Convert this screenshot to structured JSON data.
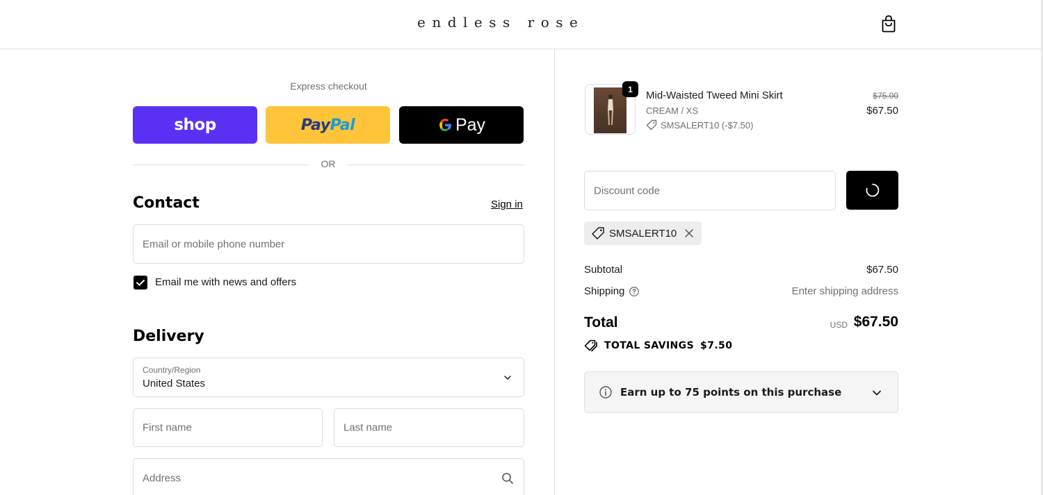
{
  "header": {
    "brand": "endless rose",
    "cart_icon": "shopping-bag-icon"
  },
  "express": {
    "title": "Express checkout",
    "shop_label": "shop",
    "paypal_label_1": "Pay",
    "paypal_label_2": "Pal",
    "gpay_g": "G",
    "gpay_label": "Pay",
    "or_label": "OR"
  },
  "contact": {
    "title": "Contact",
    "sign_in": "Sign in",
    "email_placeholder": "Email or mobile phone number",
    "newsletter_label": "Email me with news and offers",
    "newsletter_checked": true
  },
  "delivery": {
    "title": "Delivery",
    "country_label": "Country/Region",
    "country_value": "United States",
    "first_name_placeholder": "First name",
    "last_name_placeholder": "Last name",
    "address_placeholder": "Address"
  },
  "cart": {
    "item": {
      "quantity": "1",
      "name": "Mid-Waisted Tweed Mini Skirt",
      "variant": "CREAM / XS",
      "discount": "SMSALERT10 (-$7.50)",
      "original_price": "$75.00",
      "price": "$67.50"
    },
    "discount_placeholder": "Discount code",
    "applied_code": "SMSALERT10",
    "subtotal_label": "Subtotal",
    "subtotal_value": "$67.50",
    "shipping_label": "Shipping",
    "shipping_value": "Enter shipping address",
    "total_label": "Total",
    "currency": "USD",
    "total_value": "$67.50",
    "savings_label": "TOTAL SAVINGS",
    "savings_value": "$7.50",
    "points_text": "Earn up to 75 points on this purchase"
  },
  "colors": {
    "shop_pay": "#5a31f4",
    "paypal": "#ffc439",
    "gpay": "#000000",
    "border": "#dedede",
    "muted_text": "#707070"
  }
}
